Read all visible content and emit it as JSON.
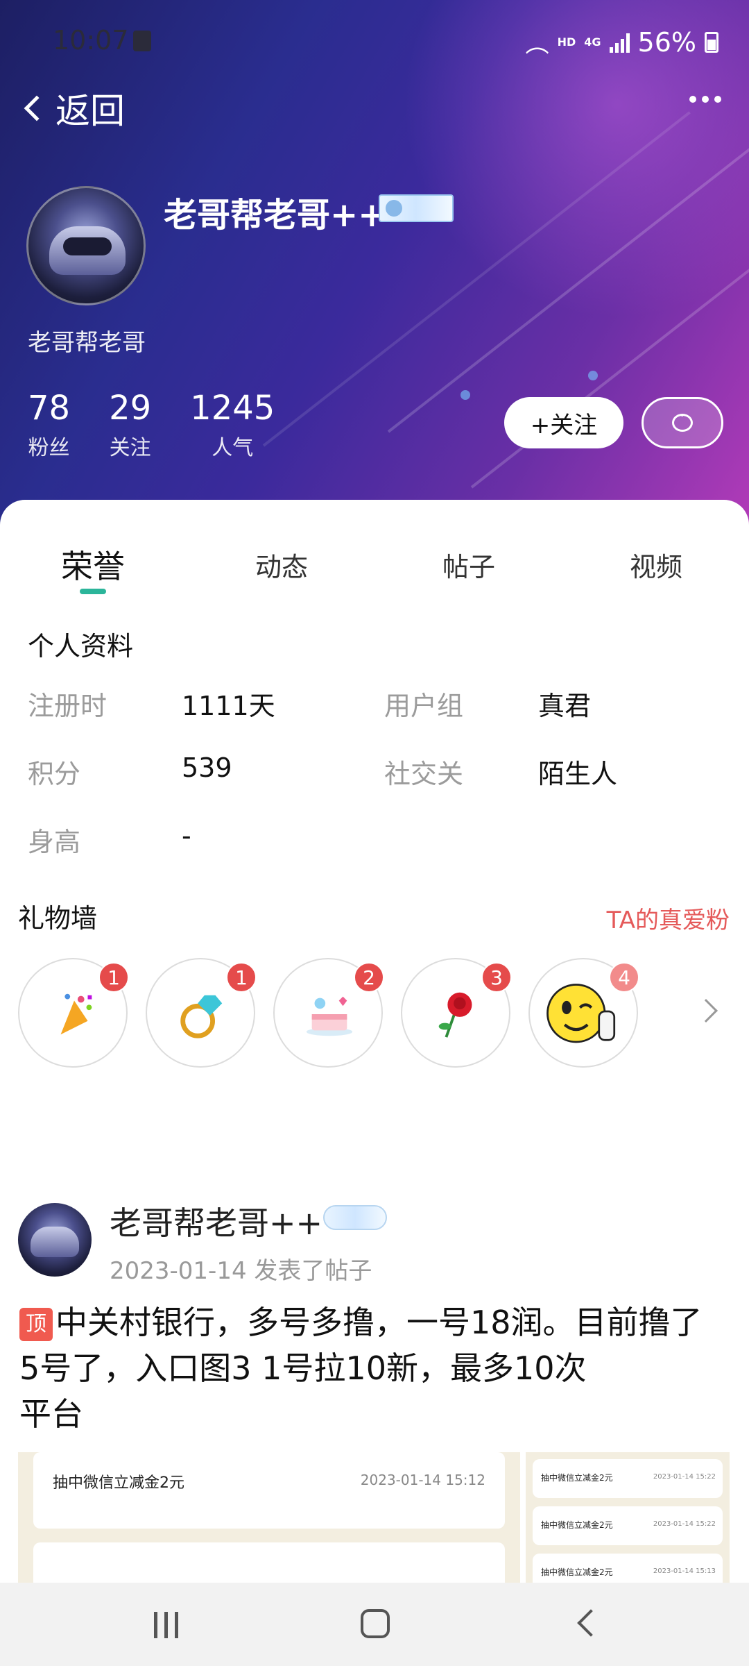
{
  "status_bar": {
    "time": "10:07",
    "network_hd": "HD",
    "network_gen": "4G",
    "battery": "56%"
  },
  "header": {
    "back_label": "返回",
    "username": "老哥帮老哥++",
    "signature": "老哥帮老哥",
    "stats": [
      {
        "value": "78",
        "label": "粉丝"
      },
      {
        "value": "29",
        "label": "关注"
      },
      {
        "value": "1245",
        "label": "人气"
      }
    ],
    "follow_label": "+关注"
  },
  "tabs": [
    "荣誉",
    "动态",
    "帖子",
    "视频"
  ],
  "profile": {
    "title": "个人资料",
    "rows": [
      {
        "label": "注册时",
        "value": "1111天"
      },
      {
        "label": "用户组",
        "value": "真君"
      },
      {
        "label": "积分",
        "value": "539"
      },
      {
        "label": "社交关",
        "value": "陌生人"
      },
      {
        "label": "身高",
        "value": "-"
      }
    ]
  },
  "gifts": {
    "title": "礼物墙",
    "link": "TA的真爱粉",
    "items": [
      {
        "icon": "party-popper-icon",
        "count": "1"
      },
      {
        "icon": "diamond-ring-icon",
        "count": "1"
      },
      {
        "icon": "cake-icon",
        "count": "2"
      },
      {
        "icon": "rose-icon",
        "count": "3"
      },
      {
        "icon": "thumbs-up-emoji-icon",
        "count": "4"
      }
    ]
  },
  "post": {
    "author": "老哥帮老哥++",
    "meta": "2023-01-14 发表了帖子",
    "pin_label": "顶",
    "text_line1": "中关村银行，多号多撸，一号18润。目前撸了",
    "text_line2": "5号了，入口图3 1号拉10新，最多10次",
    "text_line3": "平台",
    "image_main_title": "抽中微信立减金2元",
    "image_main_date": "2023-01-14 15:12",
    "image_side_items": [
      {
        "title": "抽中微信立减金2元",
        "date": "2023-01-14 15:22"
      },
      {
        "title": "抽中微信立减金2元",
        "date": "2023-01-14 15:22"
      },
      {
        "title": "抽中微信立减金2元",
        "date": "2023-01-14 15:13"
      }
    ]
  }
}
